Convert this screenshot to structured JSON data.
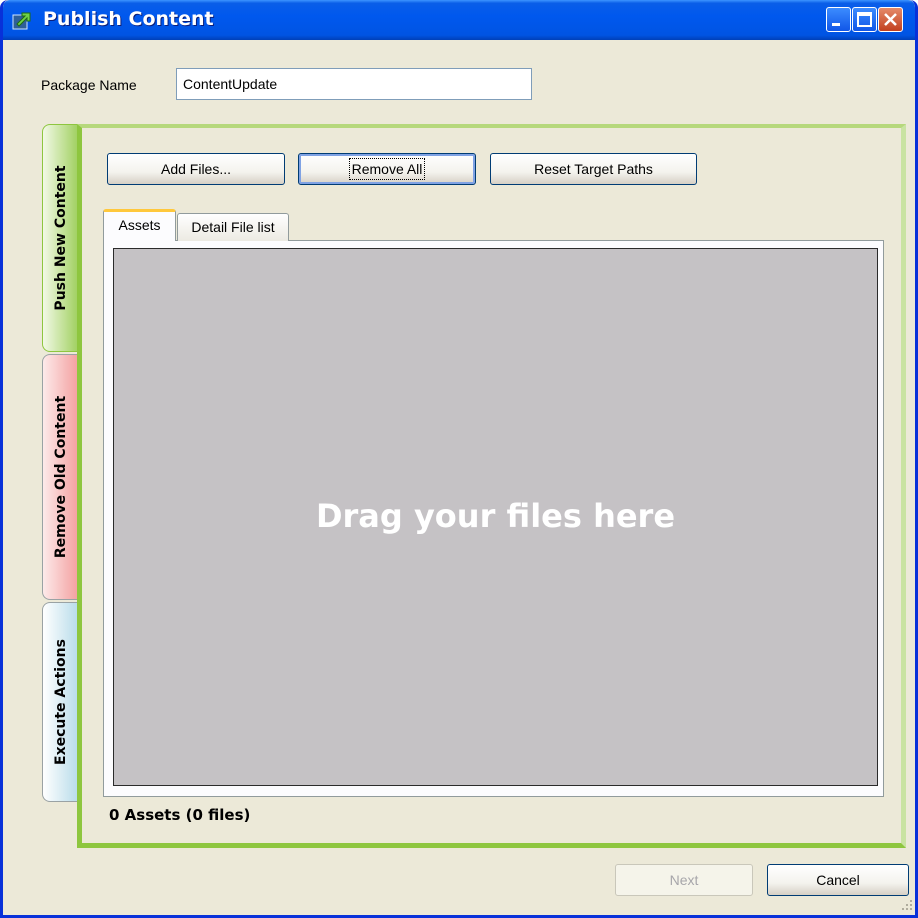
{
  "window": {
    "title": "Publish Content",
    "icon": "publish-arrow-icon",
    "controls": [
      "minimize-icon",
      "maximize-icon",
      "close-icon"
    ]
  },
  "package": {
    "label": "Package Name",
    "value": "ContentUpdate"
  },
  "side_tabs": [
    {
      "label": "Push New Content",
      "color": "#a0d060",
      "selected": true
    },
    {
      "label": "Remove Old Content",
      "color": "#f3a0a0",
      "selected": false
    },
    {
      "label": "Execute Actions",
      "color": "#b8dcea",
      "selected": false
    }
  ],
  "toolbar": {
    "add_files": "Add Files...",
    "remove_all": "Remove All",
    "reset_target_paths": "Reset Target Paths"
  },
  "inner_tabs": [
    {
      "label": "Assets",
      "selected": true
    },
    {
      "label": "Detail File list",
      "selected": false
    }
  ],
  "drop_zone": {
    "text": "Drag your files here"
  },
  "status": "0 Assets (0 files)",
  "footer": {
    "next": "Next",
    "next_enabled": false,
    "cancel": "Cancel"
  }
}
